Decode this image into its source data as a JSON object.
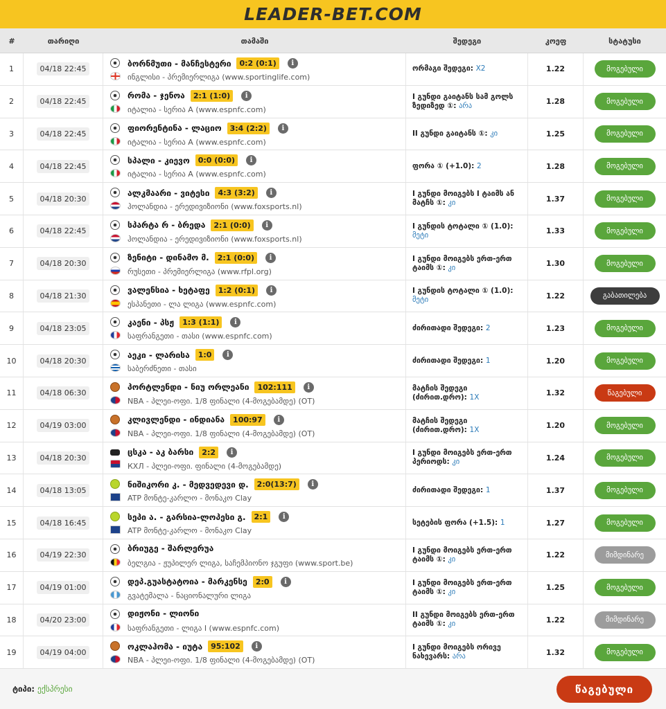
{
  "brand": {
    "logo": "LEADER-BET.COM"
  },
  "headers": {
    "num": "#",
    "date": "თარიღი",
    "game": "თამაში",
    "result": "შედეგი",
    "coef": "კოეფ",
    "status": "სტატუსი"
  },
  "rows": [
    {
      "num": "1",
      "date": "04/18 22:45",
      "sport": "soccer-ball-icon",
      "flag": "england-flag-icon",
      "teams": "ბორნმუთი - მანჩესტერი",
      "score": "0:2 (0:1)",
      "league": "ინგლისი - პრემიერლიგა (www.sportinglife.com)",
      "result": "ორმაგი შედეგი:",
      "pick": "X2",
      "coef": "1.22",
      "status": "მოგებული",
      "kind": "win"
    },
    {
      "num": "2",
      "date": "04/18 22:45",
      "sport": "soccer-ball-icon",
      "flag": "italy-flag-icon",
      "teams": "რომა - ჯენოა",
      "score": "2:1 (1:0)",
      "league": "იტალია - სერია A (www.espnfc.com)",
      "result": "I გუნდი გაიტანს სამ გოლს ზედიზედ ①:",
      "pick": "არა",
      "coef": "1.28",
      "status": "მოგებული",
      "kind": "win"
    },
    {
      "num": "3",
      "date": "04/18 22:45",
      "sport": "soccer-ball-icon",
      "flag": "italy-flag-icon",
      "teams": "ფიორენტინა - ლაციო",
      "score": "3:4 (2:2)",
      "league": "იტალია - სერია A (www.espnfc.com)",
      "result": "II გუნდი გაიტანს ①:",
      "pick": "კი",
      "coef": "1.25",
      "status": "მოგებული",
      "kind": "win"
    },
    {
      "num": "4",
      "date": "04/18 22:45",
      "sport": "soccer-ball-icon",
      "flag": "italy-flag-icon",
      "teams": "სპალი - კიევო",
      "score": "0:0 (0:0)",
      "league": "იტალია - სერია A (www.espnfc.com)",
      "result": "ფორა ① (+1.0):",
      "pick": "2",
      "coef": "1.28",
      "status": "მოგებული",
      "kind": "win"
    },
    {
      "num": "5",
      "date": "04/18 20:30",
      "sport": "soccer-ball-icon",
      "flag": "netherlands-flag-icon",
      "teams": "ალკმაარი - ვიტესი",
      "score": "4:3 (3:2)",
      "league": "ჰოლანდია - ერედივიზიონი (www.foxsports.nl)",
      "result": "I გუნდი მოიგებს I ტაიმს ან მატჩს ①:",
      "pick": "კი",
      "coef": "1.37",
      "status": "მოგებული",
      "kind": "win"
    },
    {
      "num": "6",
      "date": "04/18 22:45",
      "sport": "soccer-ball-icon",
      "flag": "netherlands-flag-icon",
      "teams": "სპარტა რ - ბრედა",
      "score": "2:1 (0:0)",
      "league": "ჰოლანდია - ერედივიზიონი (www.foxsports.nl)",
      "result": "I გუნდის ტოტალი ① (1.0):",
      "pick": "მეტი",
      "coef": "1.33",
      "status": "მოგებული",
      "kind": "win"
    },
    {
      "num": "7",
      "date": "04/18 20:30",
      "sport": "soccer-ball-icon",
      "flag": "russia-flag-icon",
      "teams": "ზენიტი - დინამო მ.",
      "score": "2:1 (0:0)",
      "league": "რუსეთი - პრემიერლიგა (www.rfpl.org)",
      "result": "I გუნდი მოიგებს ერთ-ერთ ტაიმს ①:",
      "pick": "კი",
      "coef": "1.30",
      "status": "მოგებული",
      "kind": "win"
    },
    {
      "num": "8",
      "date": "04/18 21:30",
      "sport": "soccer-ball-icon",
      "flag": "spain-flag-icon",
      "teams": "ვალენსია - ხეტაფე",
      "score": "1:2 (0:1)",
      "league": "ესპანეთი - ლა ლიგა (www.espnfc.com)",
      "result": "I გუნდის ტოტალი ① (1.0):",
      "pick": "მეტი",
      "coef": "1.22",
      "status": "გაბათილება",
      "kind": "return"
    },
    {
      "num": "9",
      "date": "04/18 23:05",
      "sport": "soccer-ball-icon",
      "flag": "france-flag-icon",
      "teams": "კაენი - პსჟ",
      "score": "1:3 (1:1)",
      "league": "საფრანგეთი - თასი (www.espnfc.com)",
      "result": "ძირითადი შედეგი:",
      "pick": "2",
      "coef": "1.23",
      "status": "მოგებული",
      "kind": "win"
    },
    {
      "num": "10",
      "date": "04/18 20:30",
      "sport": "soccer-ball-icon",
      "flag": "greece-flag-icon",
      "teams": "აეკი - ლარისა",
      "score": "1:0",
      "league": "საბერძნეთი - თასი",
      "result": "ძირითადი შედეგი:",
      "pick": "1",
      "coef": "1.20",
      "status": "მოგებული",
      "kind": "win"
    },
    {
      "num": "11",
      "date": "04/18 06:30",
      "sport": "basketball-icon",
      "flag": "nba-logo-icon",
      "teams": "პორტლენდი - ნიუ ორლეანი",
      "score": "102:111",
      "league": "NBA - პლეი-ოფი. 1/8 ფინალი (4-მოგებამდე) (OT)",
      "result": "მატჩის შედეგი (ძირით.დრო):",
      "pick": "1X",
      "coef": "1.32",
      "status": "წაგებული",
      "kind": "lose"
    },
    {
      "num": "12",
      "date": "04/19 03:00",
      "sport": "basketball-icon",
      "flag": "nba-logo-icon",
      "teams": "კლივლენდი - ინდიანა",
      "score": "100:97",
      "league": "NBA - პლეი-ოფი. 1/8 ფინალი (4-მოგებამდე) (OT)",
      "result": "მატჩის შედეგი (ძირით.დრო):",
      "pick": "1X",
      "coef": "1.20",
      "status": "მოგებული",
      "kind": "win"
    },
    {
      "num": "13",
      "date": "04/18 20:30",
      "sport": "hockey-puck-icon",
      "flag": "khl-logo-icon",
      "teams": "ცსკა - აკ ბარსი",
      "score": "2:2",
      "league": "КХЛ - პლეი-ოფი. ფინალი (4-მოგებამდე)",
      "result": "I გუნდი მოიგებს ერთ-ერთ პერიოდს:",
      "pick": "კი",
      "coef": "1.24",
      "status": "მოგებული",
      "kind": "win"
    },
    {
      "num": "14",
      "date": "04/18 13:05",
      "sport": "tennis-ball-icon",
      "flag": "atp-logo-icon",
      "teams": "ნიშიკორი კ. - მედვედევი დ.",
      "score": "2:0(13:7)",
      "league": "ATP მონტე-კარლო - მონაკო Clay",
      "result": "ძირითადი შედეგი:",
      "pick": "1",
      "coef": "1.37",
      "status": "მოგებული",
      "kind": "win"
    },
    {
      "num": "15",
      "date": "04/18 16:45",
      "sport": "tennis-ball-icon",
      "flag": "atp-logo-icon",
      "teams": "სეპი ა. - გარსია-ლოპესი გ.",
      "score": "2:1",
      "league": "ATP მონტე-კარლო - მონაკო Clay",
      "result": "სეტების ფორა (+1.5):",
      "pick": "1",
      "coef": "1.27",
      "status": "მოგებული",
      "kind": "win"
    },
    {
      "num": "16",
      "date": "04/19 22:30",
      "sport": "soccer-ball-icon",
      "flag": "belgium-flag-icon",
      "teams": "ბრიუგე - შარლერუა",
      "score": "",
      "league": "ბელგია - ჟუპილერ ლიგა, საჩემპიონო ჯგუფი (www.sport.be)",
      "result": "I გუნდი მოიგებს ერთ-ერთ ტაიმს ①:",
      "pick": "კი",
      "coef": "1.22",
      "status": "მიმდინარე",
      "kind": "pending"
    },
    {
      "num": "17",
      "date": "04/19 01:00",
      "sport": "soccer-ball-icon",
      "flag": "guatemala-flag-icon",
      "teams": "დეპ.გუასტატოია - მარკენსე",
      "score": "2:0",
      "league": "გვატემალა - ნაციონალური ლიგა",
      "result": "I გუნდი მოიგებს ერთ-ერთ ტაიმს ①:",
      "pick": "კი",
      "coef": "1.25",
      "status": "მოგებული",
      "kind": "win"
    },
    {
      "num": "18",
      "date": "04/20 23:00",
      "sport": "soccer-ball-icon",
      "flag": "france-flag-icon",
      "teams": "დიჟონი - ლიონი",
      "score": "",
      "league": "საფრანგეთი - ლიგა I (www.espnfc.com)",
      "result": "II გუნდი მოიგებს ერთ-ერთ ტაიმს ①:",
      "pick": "კი",
      "coef": "1.22",
      "status": "მიმდინარე",
      "kind": "pending"
    },
    {
      "num": "19",
      "date": "04/19 04:00",
      "sport": "basketball-icon",
      "flag": "nba-logo-icon",
      "teams": "ოკლაჰომა - იუტა",
      "score": "95:102",
      "league": "NBA - პლეი-ოფი. 1/8 ფინალი (4-მოგებამდე) (OT)",
      "result": "I გუნდი მოიგებს ორივე ნახევარს:",
      "pick": "არა",
      "coef": "1.32",
      "status": "მოგებული",
      "kind": "win"
    }
  ],
  "footer": {
    "type_label": "ტიპი:",
    "type_value": "ექსპრესი",
    "final_status": "წაგებული"
  },
  "colors": {
    "brand": "#f7c520",
    "win": "#5aa63c",
    "lose": "#c93a14",
    "return": "#3d3d3d",
    "pending": "#9c9c9c",
    "pick": "#2a7ab8"
  }
}
